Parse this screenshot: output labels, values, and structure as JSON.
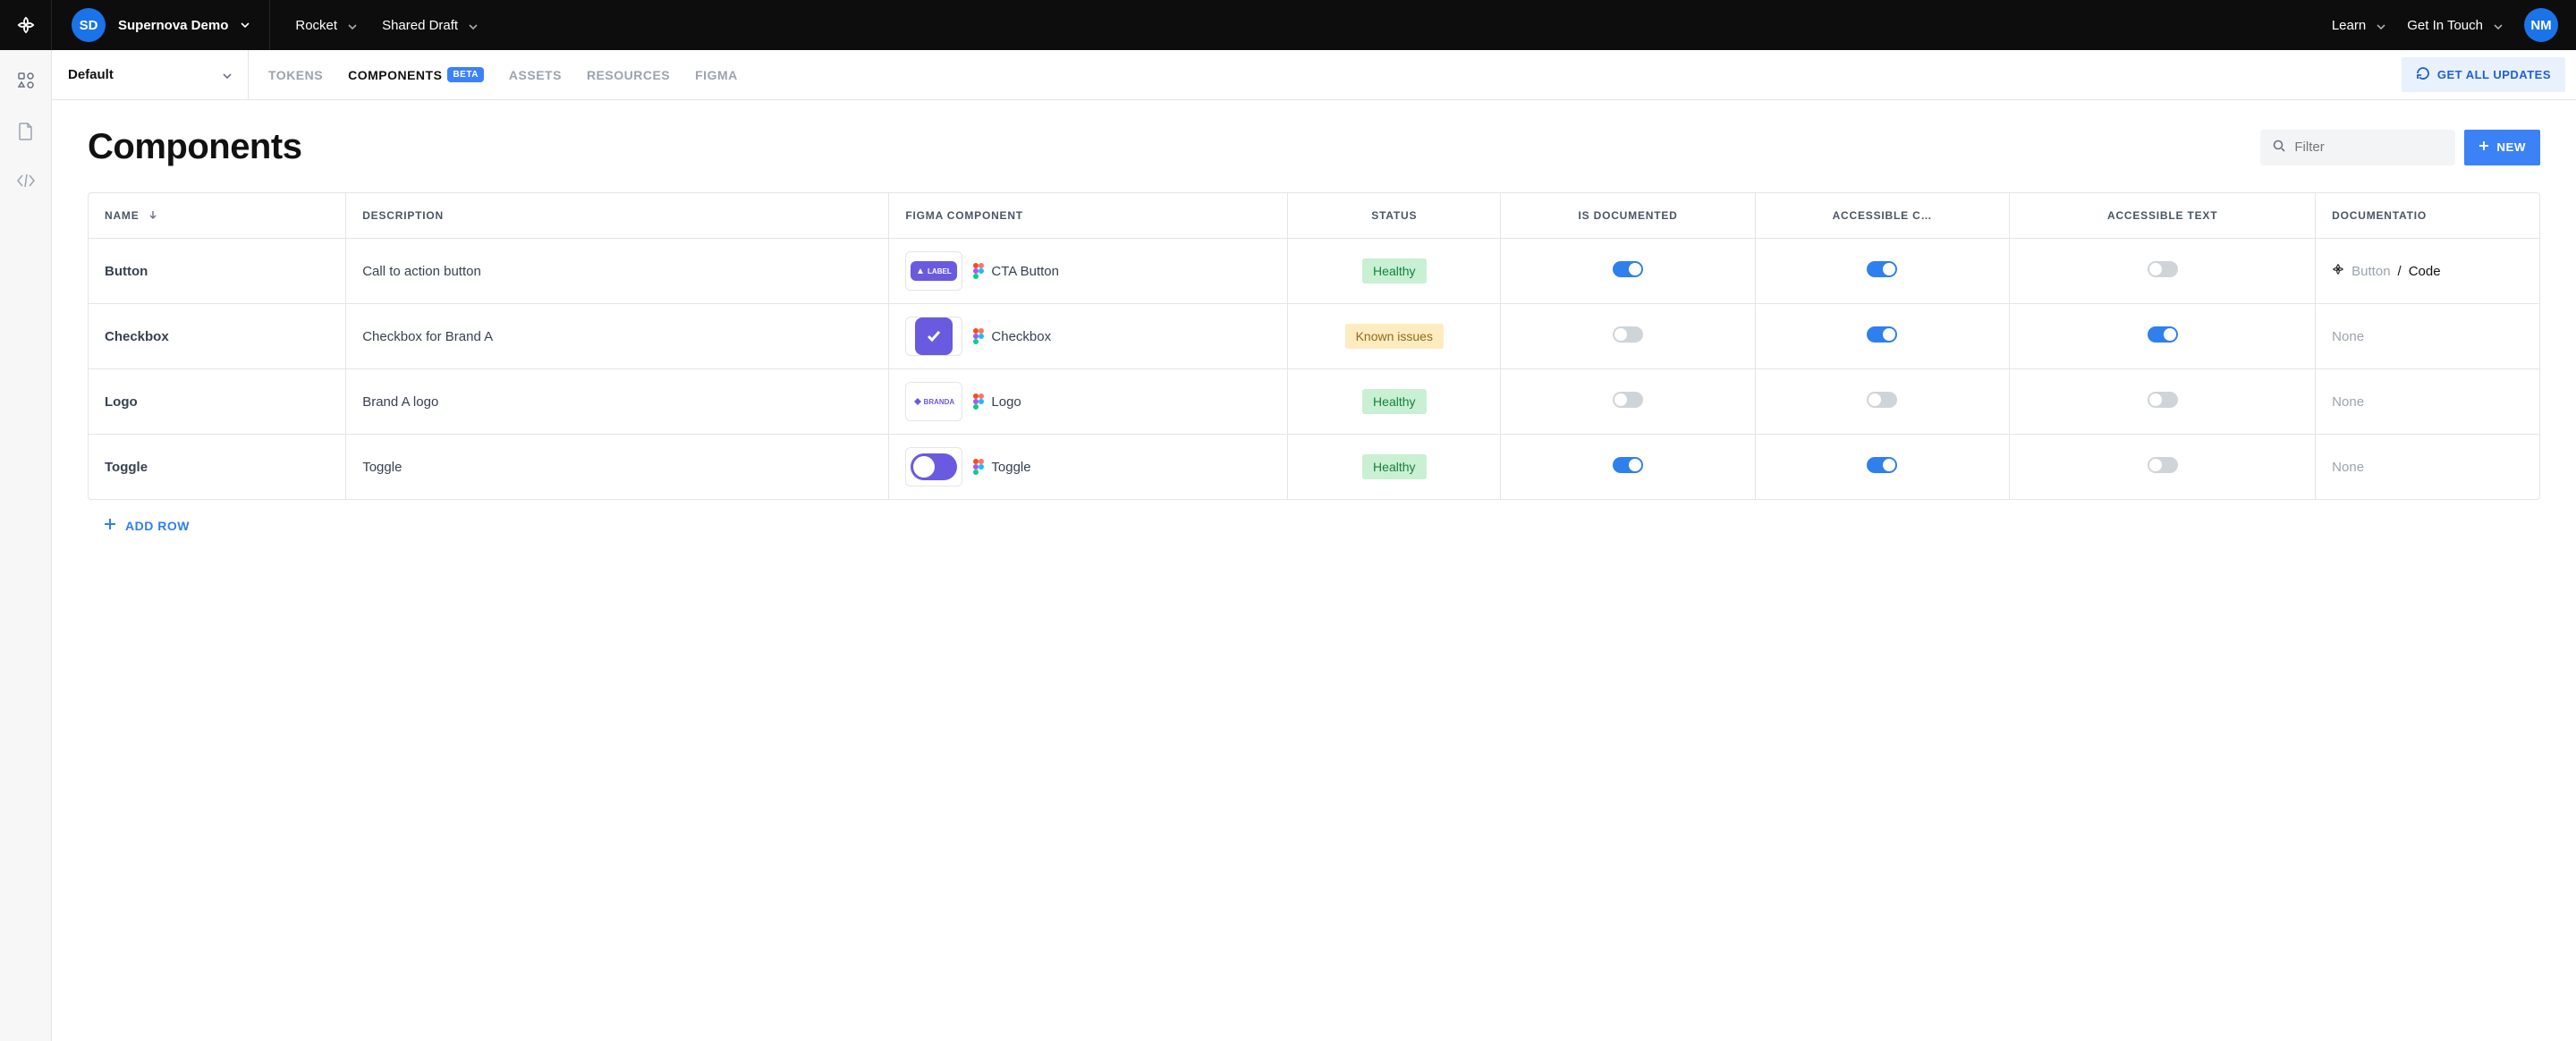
{
  "topbar": {
    "workspace_initials": "SD",
    "workspace_name": "Supernova Demo",
    "items": [
      {
        "label": "Rocket"
      },
      {
        "label": "Shared Draft"
      }
    ],
    "right": [
      {
        "label": "Learn"
      },
      {
        "label": "Get In Touch"
      }
    ],
    "user_initials": "NM"
  },
  "subbar": {
    "brand": "Default",
    "tabs": {
      "tokens": "TOKENS",
      "components": "COMPONENTS",
      "beta": "BETA",
      "assets": "ASSETS",
      "resources": "RESOURCES",
      "figma": "FIGMA"
    },
    "get_updates": "GET ALL UPDATES"
  },
  "page": {
    "title": "Components",
    "filter_placeholder": "Filter",
    "new_button": "NEW",
    "add_row": "ADD ROW"
  },
  "table": {
    "headers": {
      "name": "NAME",
      "description": "DESCRIPTION",
      "figma": "FIGMA COMPONENT",
      "status": "STATUS",
      "documented": "IS DOCUMENTED",
      "a11y_c": "ACCESSIBLE C…",
      "a11y_text": "ACCESSIBLE TEXT",
      "documentation": "DOCUMENTATIO"
    },
    "rows": [
      {
        "name": "Button",
        "description": "Call to action button",
        "figma_thumb": "label",
        "figma_name": "CTA Button",
        "status": "Healthy",
        "status_kind": "healthy",
        "documented": true,
        "a11y_c": true,
        "a11y_text": false,
        "doc": {
          "type": "link",
          "path": "Button",
          "subpath": "Code"
        }
      },
      {
        "name": "Checkbox",
        "description": "Checkbox for Brand A",
        "figma_thumb": "checkbox",
        "figma_name": "Checkbox",
        "status": "Known issues",
        "status_kind": "known",
        "documented": false,
        "a11y_c": true,
        "a11y_text": true,
        "doc": {
          "type": "none",
          "text": "None"
        }
      },
      {
        "name": "Logo",
        "description": "Brand A logo",
        "figma_thumb": "branda",
        "figma_name": "Logo",
        "status": "Healthy",
        "status_kind": "healthy",
        "documented": false,
        "a11y_c": false,
        "a11y_text": false,
        "doc": {
          "type": "none",
          "text": "None"
        }
      },
      {
        "name": "Toggle",
        "description": "Toggle",
        "figma_thumb": "toggle",
        "figma_name": "Toggle",
        "status": "Healthy",
        "status_kind": "healthy",
        "documented": true,
        "a11y_c": true,
        "a11y_text": false,
        "doc": {
          "type": "none",
          "text": "None"
        }
      }
    ]
  }
}
